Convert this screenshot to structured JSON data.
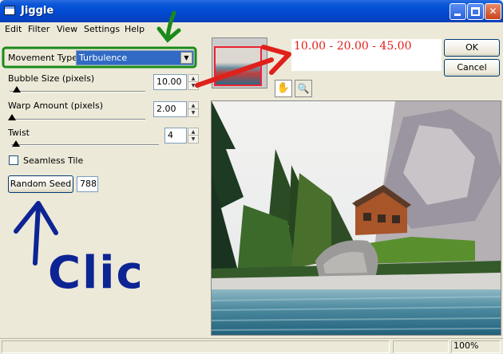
{
  "window": {
    "title": "Jiggle",
    "colors": {
      "titlebar": "#0a56d8",
      "face": "#ece9d8"
    }
  },
  "menu": [
    "Edit",
    "Filter",
    "View",
    "Settings",
    "Help"
  ],
  "controls": {
    "movement_type": {
      "label": "Movement Type:",
      "value": "Turbulence"
    },
    "bubble_size": {
      "label": "Bubble Size (pixels)",
      "value": "10.00",
      "slider_fraction": 0.05
    },
    "warp_amount": {
      "label": "Warp Amount (pixels)",
      "value": "2.00",
      "slider_fraction": 0.02
    },
    "twist": {
      "label": "Twist",
      "value": "4",
      "slider_fraction": 0.03
    },
    "seamless_tile": {
      "label": "Seamless Tile",
      "checked": false
    },
    "random_seed": {
      "label": "Random Seed",
      "value": "788"
    }
  },
  "buttons": {
    "ok": "OK",
    "cancel": "Cancel"
  },
  "annotation": {
    "values": "10.00  -  20.00  -  45.00",
    "handwritten": "Clic",
    "colors": {
      "red": "#e0201a",
      "green": "#1a8a1a",
      "blue": "#0d2494"
    }
  },
  "preview": {
    "icons": [
      "hand-icon",
      "zoom-icon"
    ]
  },
  "statusbar": {
    "zoom": "100%"
  }
}
